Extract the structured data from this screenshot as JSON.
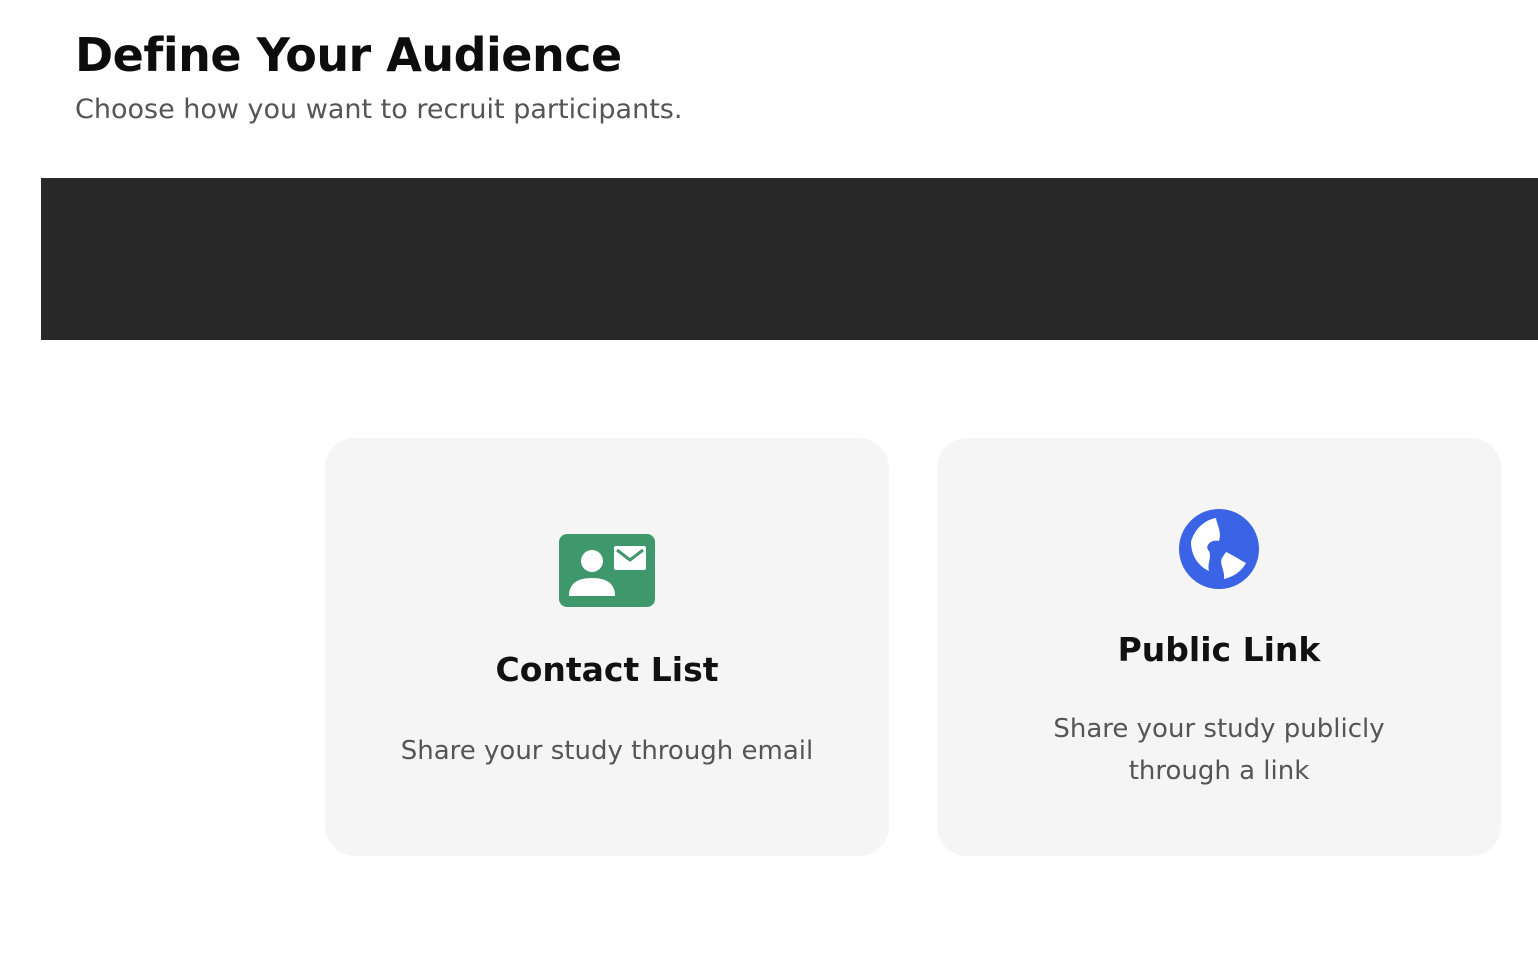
{
  "header": {
    "title": "Define Your Audience",
    "subtitle": "Choose how you want to recruit participants."
  },
  "options": [
    {
      "title": "Contact List",
      "description": "Share your study through email",
      "icon": "contact-card-icon",
      "icon_color": "#3f976c"
    },
    {
      "title": "Public Link",
      "description": "Share your study publicly through a link",
      "icon": "globe-icon",
      "icon_color": "#3a63e6"
    }
  ],
  "colors": {
    "banner": "#292929",
    "card_background": "#f5f5f5"
  }
}
